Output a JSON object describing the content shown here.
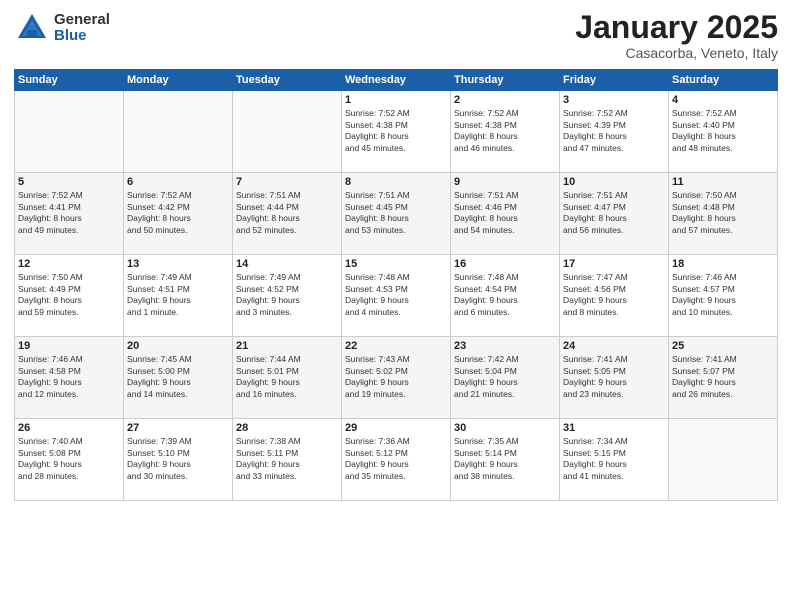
{
  "logo": {
    "general": "General",
    "blue": "Blue"
  },
  "title": "January 2025",
  "subtitle": "Casacorba, Veneto, Italy",
  "days_header": [
    "Sunday",
    "Monday",
    "Tuesday",
    "Wednesday",
    "Thursday",
    "Friday",
    "Saturday"
  ],
  "weeks": [
    [
      {
        "num": "",
        "info": ""
      },
      {
        "num": "",
        "info": ""
      },
      {
        "num": "",
        "info": ""
      },
      {
        "num": "1",
        "info": "Sunrise: 7:52 AM\nSunset: 4:38 PM\nDaylight: 8 hours\nand 45 minutes."
      },
      {
        "num": "2",
        "info": "Sunrise: 7:52 AM\nSunset: 4:38 PM\nDaylight: 8 hours\nand 46 minutes."
      },
      {
        "num": "3",
        "info": "Sunrise: 7:52 AM\nSunset: 4:39 PM\nDaylight: 8 hours\nand 47 minutes."
      },
      {
        "num": "4",
        "info": "Sunrise: 7:52 AM\nSunset: 4:40 PM\nDaylight: 8 hours\nand 48 minutes."
      }
    ],
    [
      {
        "num": "5",
        "info": "Sunrise: 7:52 AM\nSunset: 4:41 PM\nDaylight: 8 hours\nand 49 minutes."
      },
      {
        "num": "6",
        "info": "Sunrise: 7:52 AM\nSunset: 4:42 PM\nDaylight: 8 hours\nand 50 minutes."
      },
      {
        "num": "7",
        "info": "Sunrise: 7:51 AM\nSunset: 4:44 PM\nDaylight: 8 hours\nand 52 minutes."
      },
      {
        "num": "8",
        "info": "Sunrise: 7:51 AM\nSunset: 4:45 PM\nDaylight: 8 hours\nand 53 minutes."
      },
      {
        "num": "9",
        "info": "Sunrise: 7:51 AM\nSunset: 4:46 PM\nDaylight: 8 hours\nand 54 minutes."
      },
      {
        "num": "10",
        "info": "Sunrise: 7:51 AM\nSunset: 4:47 PM\nDaylight: 8 hours\nand 56 minutes."
      },
      {
        "num": "11",
        "info": "Sunrise: 7:50 AM\nSunset: 4:48 PM\nDaylight: 8 hours\nand 57 minutes."
      }
    ],
    [
      {
        "num": "12",
        "info": "Sunrise: 7:50 AM\nSunset: 4:49 PM\nDaylight: 8 hours\nand 59 minutes."
      },
      {
        "num": "13",
        "info": "Sunrise: 7:49 AM\nSunset: 4:51 PM\nDaylight: 9 hours\nand 1 minute."
      },
      {
        "num": "14",
        "info": "Sunrise: 7:49 AM\nSunset: 4:52 PM\nDaylight: 9 hours\nand 3 minutes."
      },
      {
        "num": "15",
        "info": "Sunrise: 7:48 AM\nSunset: 4:53 PM\nDaylight: 9 hours\nand 4 minutes."
      },
      {
        "num": "16",
        "info": "Sunrise: 7:48 AM\nSunset: 4:54 PM\nDaylight: 9 hours\nand 6 minutes."
      },
      {
        "num": "17",
        "info": "Sunrise: 7:47 AM\nSunset: 4:56 PM\nDaylight: 9 hours\nand 8 minutes."
      },
      {
        "num": "18",
        "info": "Sunrise: 7:46 AM\nSunset: 4:57 PM\nDaylight: 9 hours\nand 10 minutes."
      }
    ],
    [
      {
        "num": "19",
        "info": "Sunrise: 7:46 AM\nSunset: 4:58 PM\nDaylight: 9 hours\nand 12 minutes."
      },
      {
        "num": "20",
        "info": "Sunrise: 7:45 AM\nSunset: 5:00 PM\nDaylight: 9 hours\nand 14 minutes."
      },
      {
        "num": "21",
        "info": "Sunrise: 7:44 AM\nSunset: 5:01 PM\nDaylight: 9 hours\nand 16 minutes."
      },
      {
        "num": "22",
        "info": "Sunrise: 7:43 AM\nSunset: 5:02 PM\nDaylight: 9 hours\nand 19 minutes."
      },
      {
        "num": "23",
        "info": "Sunrise: 7:42 AM\nSunset: 5:04 PM\nDaylight: 9 hours\nand 21 minutes."
      },
      {
        "num": "24",
        "info": "Sunrise: 7:41 AM\nSunset: 5:05 PM\nDaylight: 9 hours\nand 23 minutes."
      },
      {
        "num": "25",
        "info": "Sunrise: 7:41 AM\nSunset: 5:07 PM\nDaylight: 9 hours\nand 26 minutes."
      }
    ],
    [
      {
        "num": "26",
        "info": "Sunrise: 7:40 AM\nSunset: 5:08 PM\nDaylight: 9 hours\nand 28 minutes."
      },
      {
        "num": "27",
        "info": "Sunrise: 7:39 AM\nSunset: 5:10 PM\nDaylight: 9 hours\nand 30 minutes."
      },
      {
        "num": "28",
        "info": "Sunrise: 7:38 AM\nSunset: 5:11 PM\nDaylight: 9 hours\nand 33 minutes."
      },
      {
        "num": "29",
        "info": "Sunrise: 7:36 AM\nSunset: 5:12 PM\nDaylight: 9 hours\nand 35 minutes."
      },
      {
        "num": "30",
        "info": "Sunrise: 7:35 AM\nSunset: 5:14 PM\nDaylight: 9 hours\nand 38 minutes."
      },
      {
        "num": "31",
        "info": "Sunrise: 7:34 AM\nSunset: 5:15 PM\nDaylight: 9 hours\nand 41 minutes."
      },
      {
        "num": "",
        "info": ""
      }
    ]
  ]
}
